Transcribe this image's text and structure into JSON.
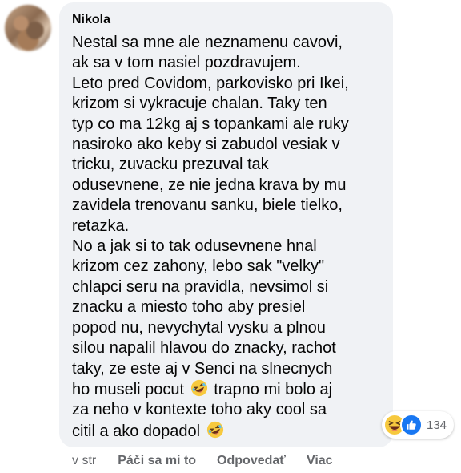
{
  "comment": {
    "author": "Nikola",
    "lines": [
      "Nestal sa mne ale neznamenu cavovi,",
      "ak sa v tom nasiel pozdravujem.",
      "Leto pred Covidom, parkovisko pri Ikei,",
      "krizom si vykracuje chalan. Taky ten",
      "typ co ma 12kg aj s topankami ale ruky",
      "nasiroko ako keby si zabudol vesiak v",
      "tricku, zuvacku prezuval tak",
      "odusevnene, ze nie jedna krava by mu",
      "zavidela trenovanu sanku, biele tielko,",
      "retazka.",
      "No a jak si to tak odusevnene hnal",
      "krizom cez zahony, lebo sak \"velky\"",
      "chlapci seru na pravidla, nevsimol si",
      "znacku a miesto toho aby presiel",
      "popod nu, nevychytal vysku a plnou",
      "silou napalil hlavou do znacky, rachot",
      "taky, ze este aj v Senci na slnecnych"
    ],
    "line17_before": "ho museli pocut",
    "line17_after": "trapno mi bolo aj",
    "line18": "za neho v kontexte toho aky cool sa",
    "line19_before": "citil a ako dopadol",
    "emoji_name": "rolling-on-floor-laughing-emoji"
  },
  "reactions": {
    "count": "134",
    "icons": [
      "haha-reaction-icon",
      "like-reaction-icon"
    ],
    "like_color": "#1877f2",
    "haha_color": "#f7c93e"
  },
  "actions": {
    "time": "v str",
    "like": "Páči sa mi to",
    "reply": "Odpovedať",
    "more": "Viac"
  },
  "colors": {
    "bubble": "#f0f2f5",
    "text": "#050505",
    "secondary": "#65676b"
  }
}
